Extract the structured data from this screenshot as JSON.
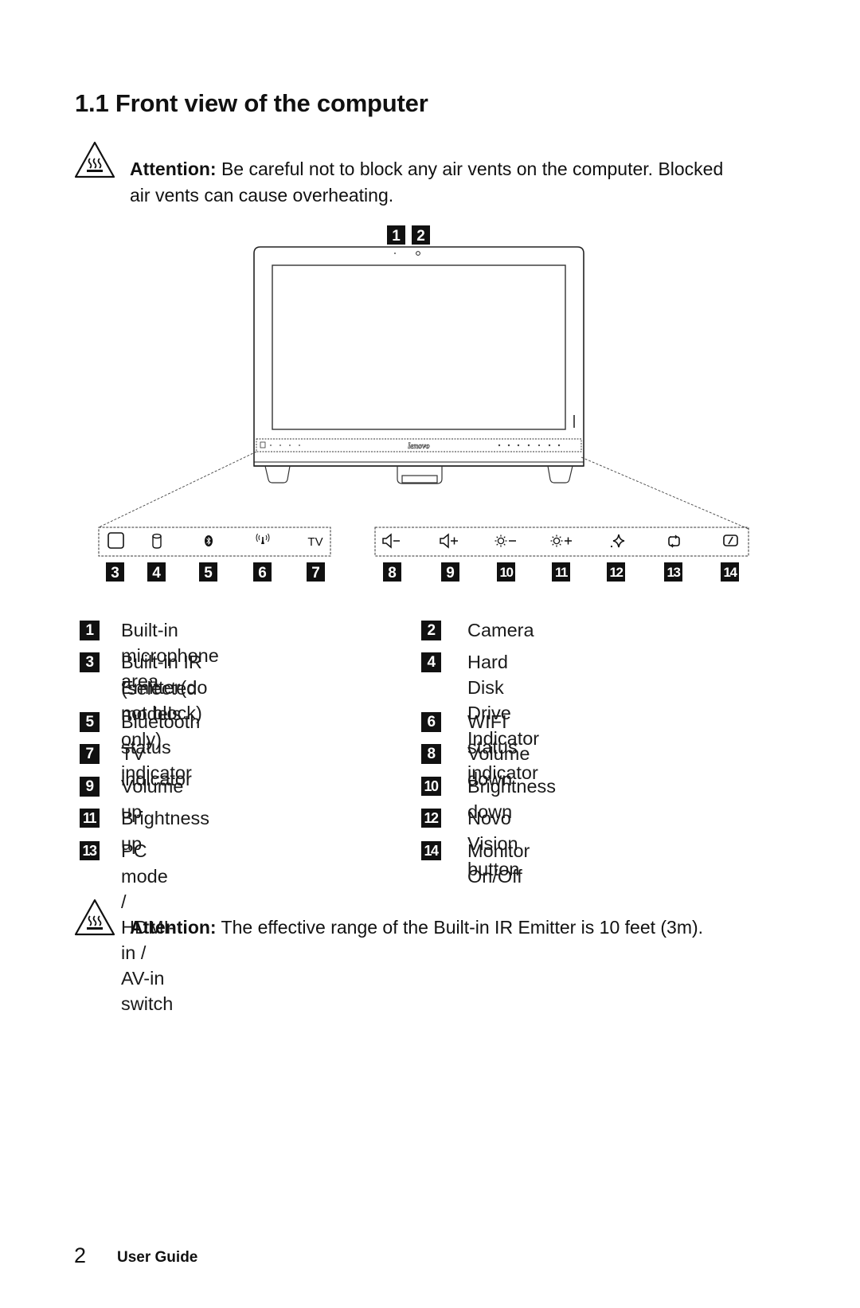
{
  "page": {
    "title": "1.1 Front view of the computer",
    "attention_top": {
      "label": "Attention:",
      "text_line1": " Be careful not to block any air vents on the computer. Blocked",
      "text_line2": "air vents can cause overheating.",
      "icon": "hot-surface-warning-icon"
    },
    "attention_bottom": {
      "label": "Attention:",
      "text": " The effective range of the Built-in IR Emitter is 10 feet (3m).",
      "icon": "hot-surface-warning-icon"
    },
    "diagram": {
      "top_callouts": [
        "1",
        "2"
      ],
      "brand_logo": "lenovo",
      "left_panel_icons": [
        {
          "callout": "3",
          "icon": "ir-emitter-square-icon"
        },
        {
          "callout": "4",
          "icon": "hard-disk-icon"
        },
        {
          "callout": "5",
          "icon": "bluetooth-icon"
        },
        {
          "callout": "6",
          "icon": "wifi-antenna-icon"
        },
        {
          "callout": "7",
          "icon": "tv-icon",
          "glyph": "TV"
        }
      ],
      "right_panel_icons": [
        {
          "callout": "8",
          "icon": "volume-down-icon"
        },
        {
          "callout": "9",
          "icon": "volume-up-icon"
        },
        {
          "callout": "10",
          "icon": "brightness-down-icon"
        },
        {
          "callout": "11",
          "icon": "brightness-up-icon"
        },
        {
          "callout": "12",
          "icon": "novo-vision-icon"
        },
        {
          "callout": "13",
          "icon": "input-switch-icon"
        },
        {
          "callout": "14",
          "icon": "monitor-power-icon"
        }
      ]
    },
    "legend": [
      {
        "num": "1",
        "text": "Built-in microphone area"
      },
      {
        "num": "2",
        "text": "Camera"
      },
      {
        "num": "3",
        "text": "Built-in IR Emitter(do not block)",
        "text2": "(selected models only)"
      },
      {
        "num": "4",
        "text": "Hard Disk Drive Indicator"
      },
      {
        "num": "5",
        "text": "Bluetooth status indicator"
      },
      {
        "num": "6",
        "text": "WIFI status indicator"
      },
      {
        "num": "7",
        "text": "TV indicator"
      },
      {
        "num": "8",
        "text": "Volume down"
      },
      {
        "num": "9",
        "text": "Volume up"
      },
      {
        "num": "10",
        "text": "Brightness down"
      },
      {
        "num": "11",
        "text": "Brightness up"
      },
      {
        "num": "12",
        "text": "Novo Vision button"
      },
      {
        "num": "13",
        "text": "PC mode / HDMI-in / AV-in switch"
      },
      {
        "num": "14",
        "text": "Monitor On/Off"
      }
    ],
    "footer": {
      "page_number": "2",
      "label": "User Guide"
    }
  }
}
